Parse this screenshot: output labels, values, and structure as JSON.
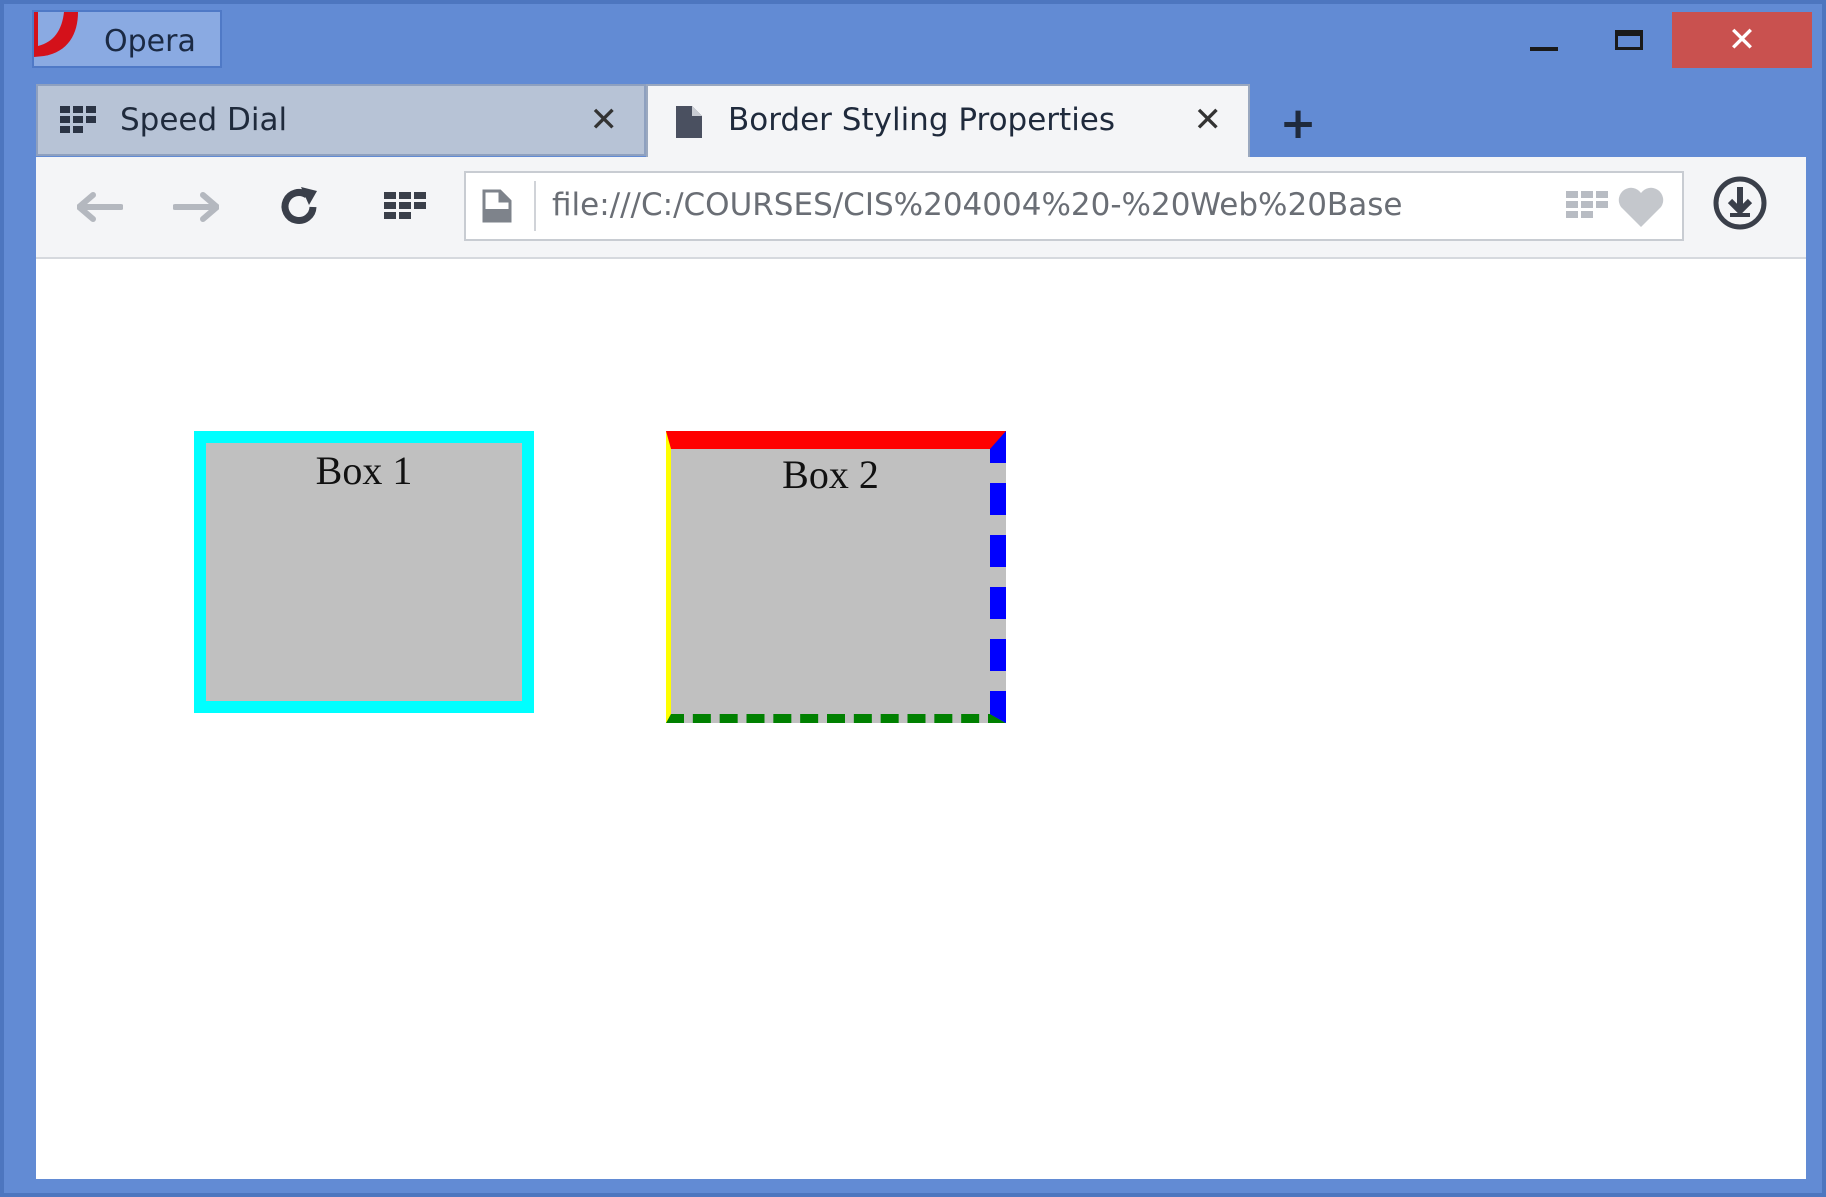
{
  "window": {
    "app_name": "Opera",
    "controls": {
      "minimize": "minimize",
      "maximize": "maximize",
      "close": "✕"
    },
    "colors": {
      "frame": "#628bd4",
      "close": "#c9514f",
      "opera_red": "#d4111a"
    }
  },
  "tabs": [
    {
      "label": "Speed Dial",
      "icon": "grid-icon",
      "close": "✕",
      "active": false
    },
    {
      "label": "Border Styling Properties",
      "icon": "page-icon",
      "close": "✕",
      "active": true
    }
  ],
  "new_tab_label": "+",
  "toolbar": {
    "back": "🡐",
    "forward": "🡒",
    "reload": "reload",
    "speed_dial": "speed-dial",
    "address": "file:///C:/COURSES/CIS%204004%20-%20Web%20Base",
    "download": "download"
  },
  "page": {
    "box1": {
      "label": "Box 1",
      "border_color": "#00ffff",
      "background": "#c0c0c0"
    },
    "box2": {
      "label": "Box 2",
      "background": "#c0c0c0",
      "border_top": "#ff0000",
      "border_right": "#0000ff",
      "border_bottom": "#008000",
      "border_left": "#ffff00"
    }
  }
}
